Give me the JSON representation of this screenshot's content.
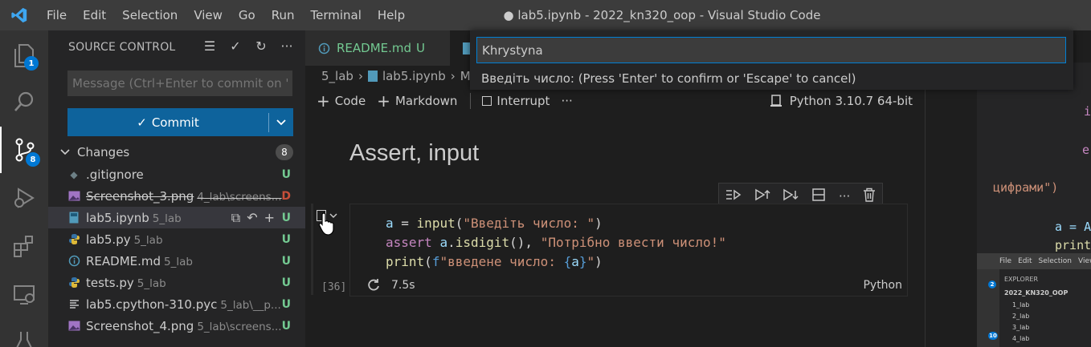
{
  "window": {
    "title": "● lab5.ipynb - 2022_kn320_oop - Visual Studio Code",
    "menu": [
      "File",
      "Edit",
      "Selection",
      "View",
      "Go",
      "Run",
      "Terminal",
      "Help"
    ]
  },
  "activity": {
    "explorer_badge": "1",
    "scm_badge": "8"
  },
  "scm": {
    "header": "SOURCE CONTROL",
    "message_placeholder": "Message (Ctrl+Enter to commit on '...",
    "commit_label": "Commit",
    "changes_label": "Changes",
    "changes_count": "8",
    "files": [
      {
        "name": ".gitignore",
        "dir": "",
        "status": "U",
        "icon": "gear-file-icon"
      },
      {
        "name": "Screenshot_3.png",
        "dir": "4_lab\\screens...",
        "status": "D",
        "icon": "image-file-icon"
      },
      {
        "name": "lab5.ipynb",
        "dir": "5_lab",
        "status": "U",
        "icon": "notebook-file-icon"
      },
      {
        "name": "lab5.py",
        "dir": "5_lab",
        "status": "U",
        "icon": "python-file-icon"
      },
      {
        "name": "README.md",
        "dir": "5_lab",
        "status": "U",
        "icon": "info-file-icon"
      },
      {
        "name": "tests.py",
        "dir": "5_lab",
        "status": "U",
        "icon": "python-file-icon"
      },
      {
        "name": "lab5.cpython-310.pyc",
        "dir": "5_lab\\__p...",
        "status": "U",
        "icon": "lines-file-icon"
      },
      {
        "name": "Screenshot_4.png",
        "dir": "5_lab\\screens...",
        "status": "U",
        "icon": "image-file-icon"
      }
    ]
  },
  "editor": {
    "tab_readme": "README.md",
    "tab_readme_status": "U",
    "breadcrumb": [
      "5_lab",
      "lab5.ipynb",
      "M"
    ],
    "toolbar": {
      "code": "Code",
      "markdown": "Markdown",
      "interrupt": "Interrupt",
      "more": "···",
      "kernel": "Python 3.10.7 64-bit"
    },
    "heading": "Assert, input",
    "cell": {
      "exec_count": "[36]",
      "duration": "7.5s",
      "language": "Python"
    }
  },
  "quick_input": {
    "value": "Khrystyna",
    "hint": "Введіть число: (Press 'Enter' to confirm or 'Escape' to cancel)"
  },
  "right_pane": {
    "line1": "i",
    "line2": "e",
    "line3": "цифрами\")",
    "line4": "a = A",
    "line5": "print",
    "shot_menu": [
      "File",
      "Edit",
      "Selection",
      "View"
    ],
    "shot_explorer": "EXPLORER",
    "shot_root": "2022_KN320_OOP",
    "shot_folders": [
      "1_lab",
      "2_lab",
      "3_lab",
      "4_lab"
    ],
    "shot_badge1": "2",
    "shot_badge2": "10"
  }
}
